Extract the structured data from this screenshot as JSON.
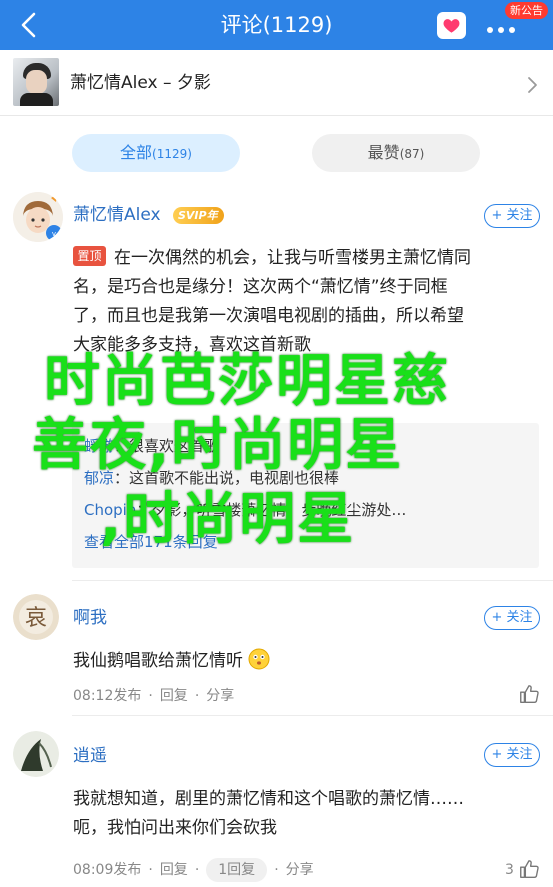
{
  "topbar": {
    "title": "评论(1129)",
    "notice_badge": "新公告"
  },
  "song": {
    "title": "萧忆情Alex – 夕影"
  },
  "tabs": {
    "all_label": "全部",
    "all_count": "(1129)",
    "hot_label": "最赞",
    "hot_count": "(87)"
  },
  "comments": [
    {
      "user": "萧忆情Alex",
      "vip": "SVIP年",
      "follow": "+ 关注",
      "pinned": "置顶",
      "lines": [
        "在一次偶然的机会，让我与听雪楼男主萧忆情同",
        "名，是巧合也是缘分！这次两个“萧忆情”终于同框",
        "了，而且也是我第一次演唱电视剧的插曲，所以希望",
        "大家能多多支持，喜欢这首新歌"
      ],
      "replies": [
        {
          "name": "蜉蝣",
          "text": "：很喜欢这首歌"
        },
        {
          "name": "郁凉",
          "text": "：这首歌不能出说，电视剧也很棒"
        },
        {
          "name": "Chopin",
          "text": "：夕影，听雪楼萧忆情，步晚红尘游处…"
        }
      ],
      "view_more": "查看全部171条回复"
    },
    {
      "user": "啊我",
      "follow": "+ 关注",
      "lines": [
        "我仙鹅唱歌给萧忆情听"
      ],
      "time": "08:12发布",
      "reply": "回复",
      "share": "分享"
    },
    {
      "user": "逍遥",
      "follow": "+ 关注",
      "lines": [
        "我就想知道，剧里的萧忆情和这个唱歌的萧忆情……",
        "呃，我怕问出来你们会砍我"
      ],
      "time": "08:09发布",
      "reply": "回复",
      "reply_count": "1回复",
      "share": "分享",
      "likes": "3"
    }
  ],
  "overlay": {
    "line1": "时尚芭莎明星慈",
    "line2": "善夜,时尚明星",
    "line3": ",时尚明星"
  },
  "colors": {
    "primary": "#2d83e6",
    "pin": "#e8533f",
    "overlay_text": "#19e019"
  }
}
